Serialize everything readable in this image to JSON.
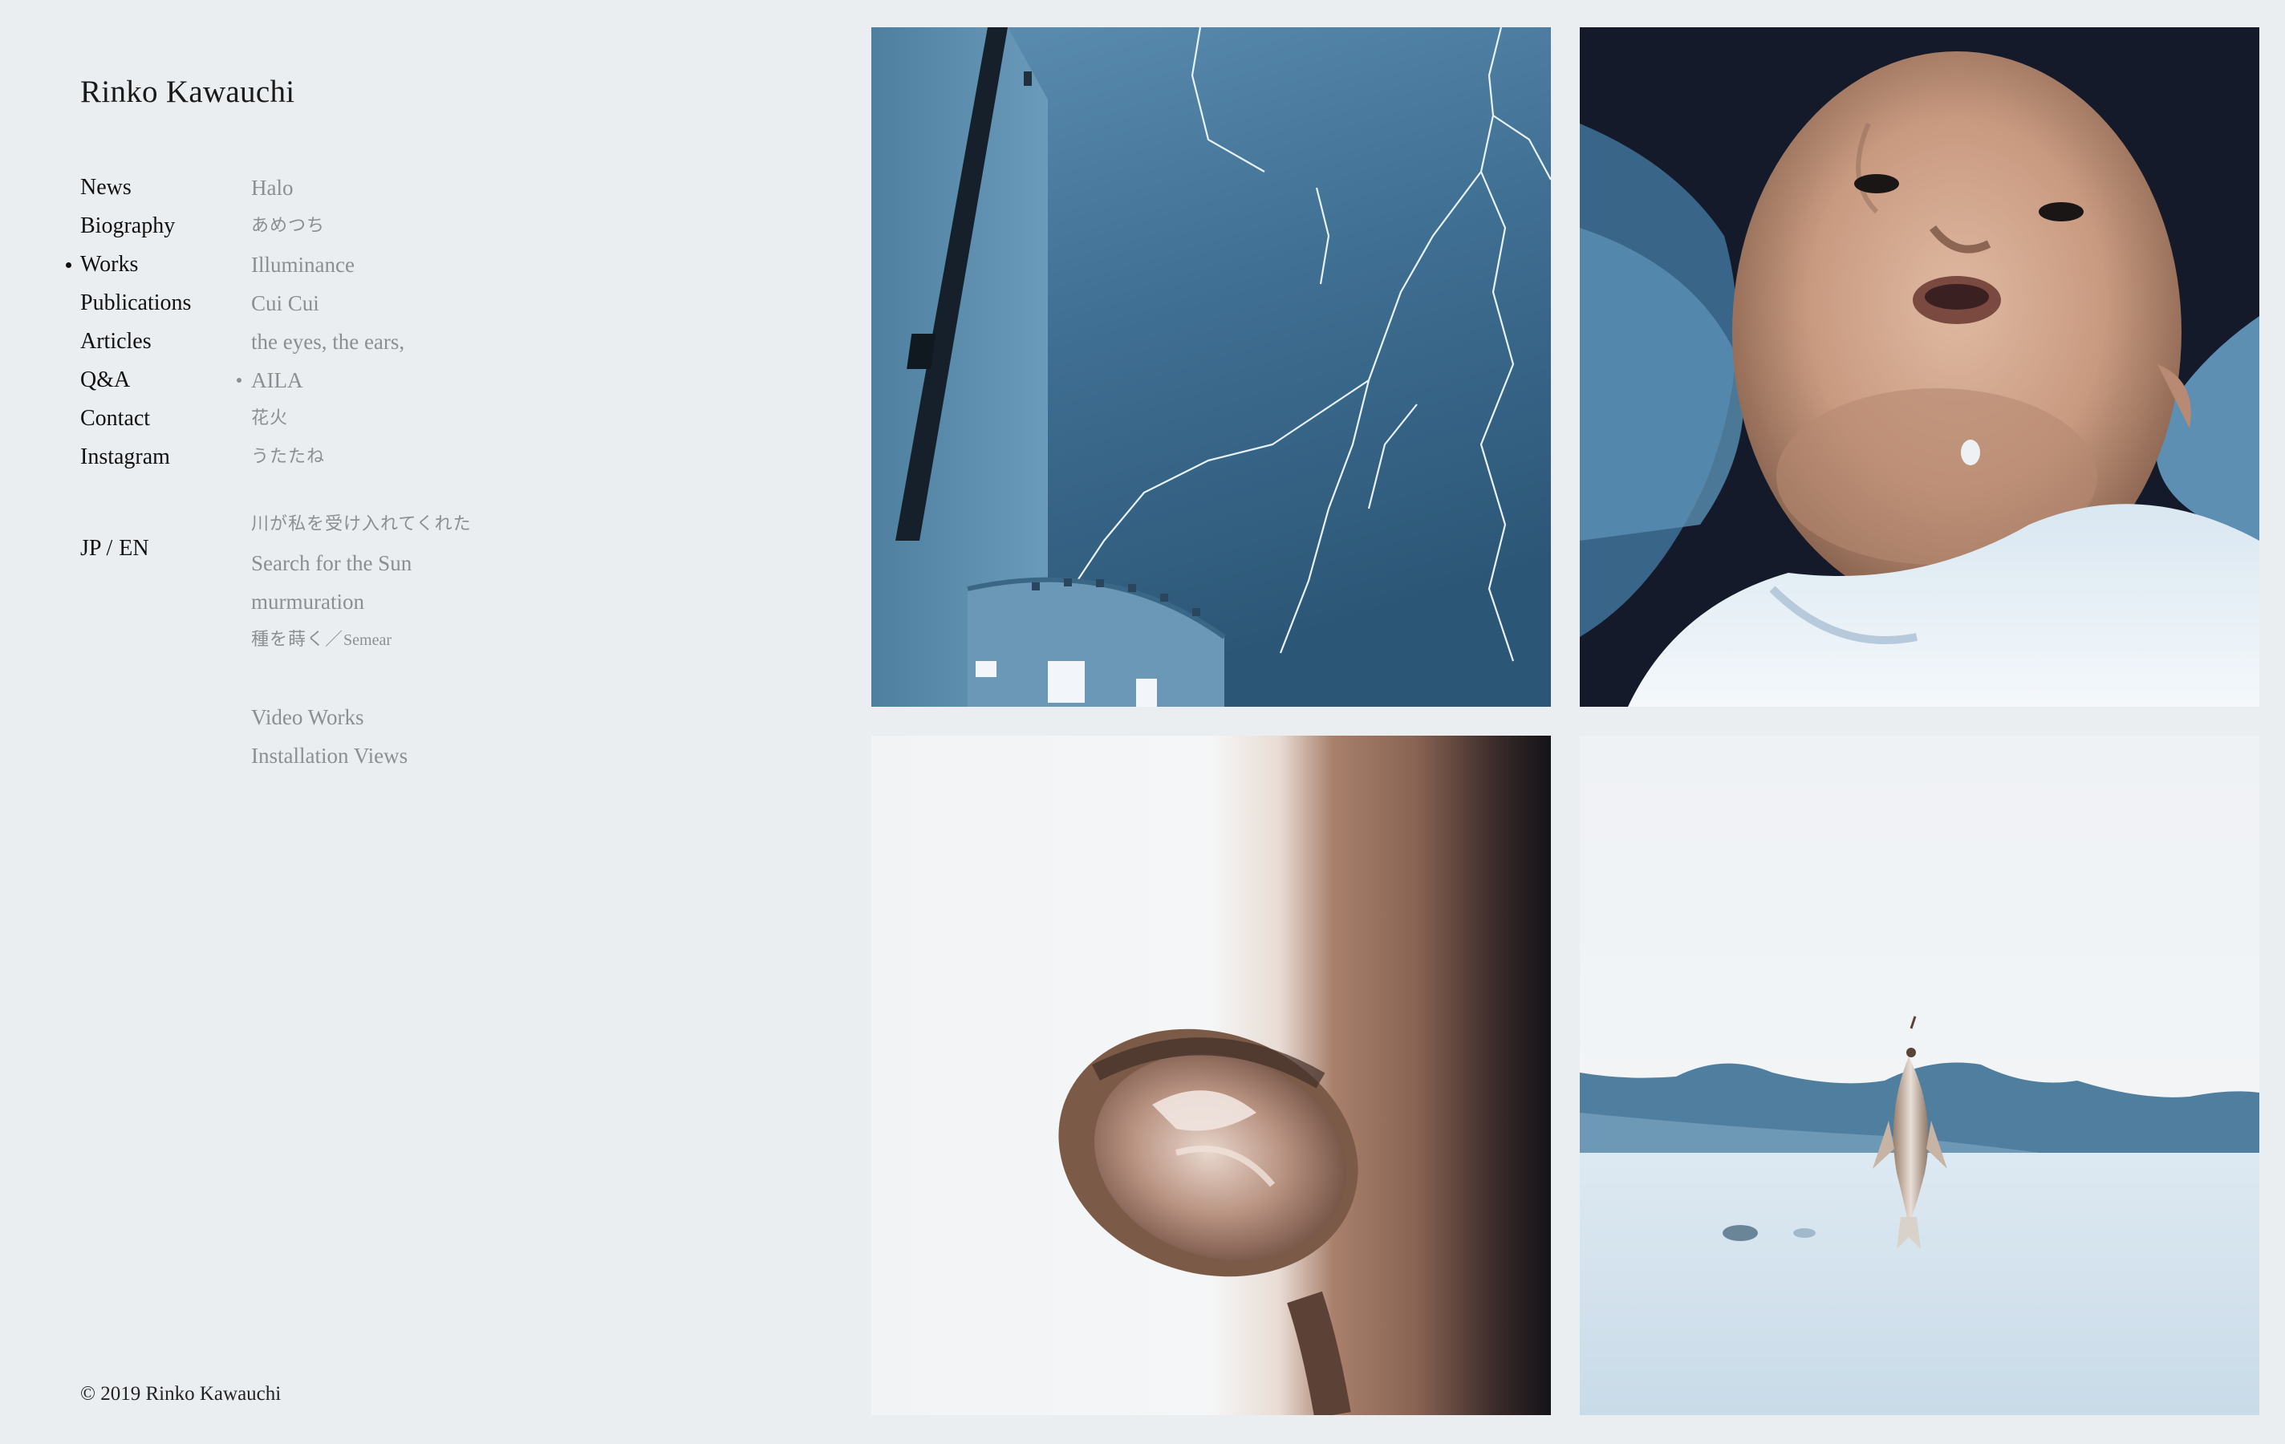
{
  "site": {
    "title": "Rinko Kawauchi"
  },
  "nav": {
    "items": [
      {
        "label": "News"
      },
      {
        "label": "Biography"
      },
      {
        "label": "Works",
        "active": true
      },
      {
        "label": "Publications"
      },
      {
        "label": "Articles"
      },
      {
        "label": "Q&A"
      },
      {
        "label": "Contact"
      },
      {
        "label": "Instagram"
      }
    ]
  },
  "lang": {
    "jp": "JP",
    "separator": "/",
    "en": "EN"
  },
  "works": {
    "items": [
      {
        "label": "Halo"
      },
      {
        "label": "あめつち"
      },
      {
        "label": "Illuminance"
      },
      {
        "label": "Cui Cui"
      },
      {
        "label": "the eyes, the ears,"
      },
      {
        "label": "AILA",
        "active": true
      },
      {
        "label": "花火"
      },
      {
        "label": "うたたね"
      },
      {
        "label": "川が私を受け入れてくれた"
      },
      {
        "label": "Search for the Sun"
      },
      {
        "label": "murmuration"
      },
      {
        "label": "種を蒔く／",
        "suffix": "Semear"
      },
      {
        "label": "Video Works"
      },
      {
        "label": "Installation Views"
      }
    ]
  },
  "footer": {
    "copyright": "© 2019 Rinko Kawauchi"
  },
  "theme": {
    "background": "#ebeef1",
    "nav_text": "#111111",
    "sub_nav_text": "#8b8e92"
  },
  "gallery": {
    "images": [
      {
        "subject": "lightning-over-building-photo"
      },
      {
        "subject": "baby-face-photo"
      },
      {
        "subject": "flower-bud-photo"
      },
      {
        "subject": "fish-above-water-photo"
      }
    ]
  }
}
